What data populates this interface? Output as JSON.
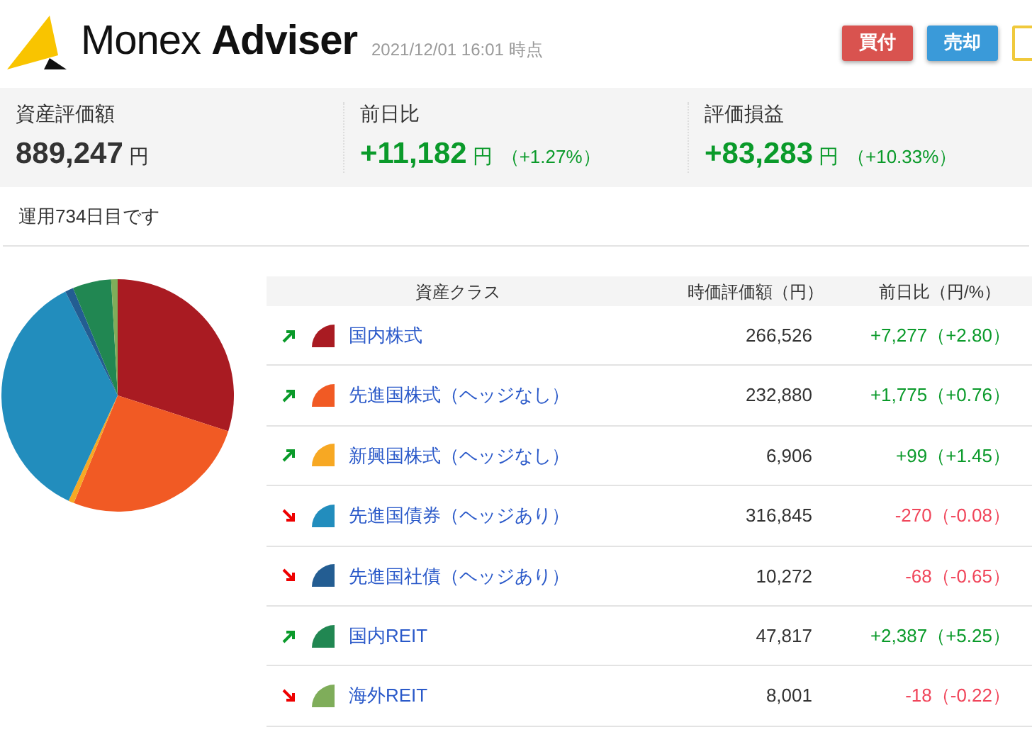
{
  "header": {
    "logo_text": "Monex",
    "logo_bold": "Adviser",
    "timestamp": "2021/12/01 16:01 時点",
    "buttons": [
      {
        "label": "買付",
        "kind": "buy"
      },
      {
        "label": "売却",
        "kind": "sell"
      }
    ]
  },
  "summary": [
    {
      "label": "資産評価額",
      "value": "889,247",
      "unit": "円",
      "kind": "neutral"
    },
    {
      "label": "前日比",
      "value": "+11,182",
      "unit": "円",
      "percent": "（+1.27%）",
      "kind": "up"
    },
    {
      "label": "評価損益",
      "value": "+83,283",
      "unit": "円",
      "percent": "（+10.33%）",
      "kind": "up"
    }
  ],
  "days_note": "運用734日目です",
  "table": {
    "columns": [
      "資産クラス",
      "時価評価額（円）",
      "前日比（円/%）"
    ],
    "rows": [
      {
        "name": "国内株式",
        "amount": "266,526",
        "change": "+7,277（+2.80）",
        "kind": "up",
        "color": "#a91b22"
      },
      {
        "name": "先進国株式（ヘッジなし）",
        "amount": "232,880",
        "change": "+1,775（+0.76）",
        "kind": "up",
        "color": "#f15a24"
      },
      {
        "name": "新興国株式（ヘッジなし）",
        "amount": "6,906",
        "change": "+99（+1.45）",
        "kind": "up",
        "color": "#f7a823"
      },
      {
        "name": "先進国債券（ヘッジあり）",
        "amount": "316,845",
        "change": "-270（-0.08）",
        "kind": "down",
        "color": "#228dbd"
      },
      {
        "name": "先進国社債（ヘッジあり）",
        "amount": "10,272",
        "change": "-68（-0.65）",
        "kind": "down",
        "color": "#235d92"
      },
      {
        "name": "国内REIT",
        "amount": "47,817",
        "change": "+2,387（+5.25）",
        "kind": "up",
        "color": "#218752"
      },
      {
        "name": "海外REIT",
        "amount": "8,001",
        "change": "-18（-0.22）",
        "kind": "down",
        "color": "#7fad5a"
      }
    ]
  }
}
